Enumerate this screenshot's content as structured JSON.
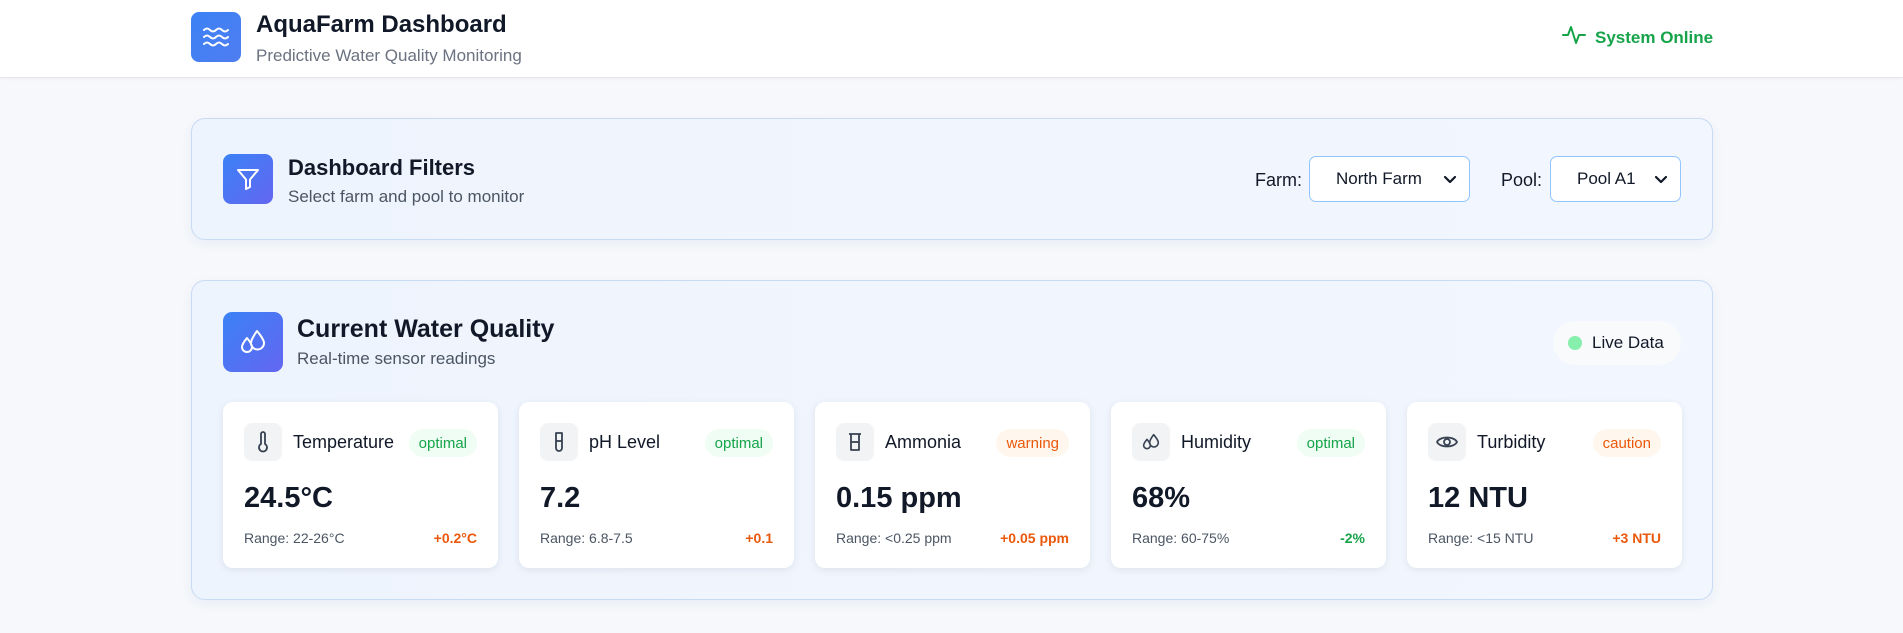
{
  "header": {
    "title": "AquaFarm Dashboard",
    "subtitle": "Predictive Water Quality Monitoring",
    "status": "System Online"
  },
  "filters": {
    "title": "Dashboard Filters",
    "subtitle": "Select farm and pool to monitor",
    "farm_label": "Farm:",
    "farm_value": "North Farm",
    "pool_label": "Pool:",
    "pool_value": "Pool A1"
  },
  "water_quality": {
    "title": "Current Water Quality",
    "subtitle": "Real-time sensor readings",
    "live_label": "Live Data",
    "cards": [
      {
        "icon": "thermometer-icon",
        "name": "Temperature",
        "status": "optimal",
        "value": "24.5°C",
        "range": "Range: 22-26°C",
        "delta": "+0.2°C",
        "trend": "up"
      },
      {
        "icon": "test-tube-icon",
        "name": "pH Level",
        "status": "optimal",
        "value": "7.2",
        "range": "Range: 6.8-7.5",
        "delta": "+0.1",
        "trend": "up"
      },
      {
        "icon": "beaker-icon",
        "name": "Ammonia",
        "status": "warning",
        "value": "0.15 ppm",
        "range": "Range: <0.25 ppm",
        "delta": "+0.05 ppm",
        "trend": "up"
      },
      {
        "icon": "droplets-icon",
        "name": "Humidity",
        "status": "optimal",
        "value": "68%",
        "range": "Range: 60-75%",
        "delta": "-2%",
        "trend": "down"
      },
      {
        "icon": "eye-icon",
        "name": "Turbidity",
        "status": "caution",
        "value": "12 NTU",
        "range": "Range: <15 NTU",
        "delta": "+3 NTU",
        "trend": "up"
      }
    ]
  },
  "colors": {
    "accent": "#3b82f6",
    "online": "#16a34a",
    "warning": "#ea580c"
  }
}
